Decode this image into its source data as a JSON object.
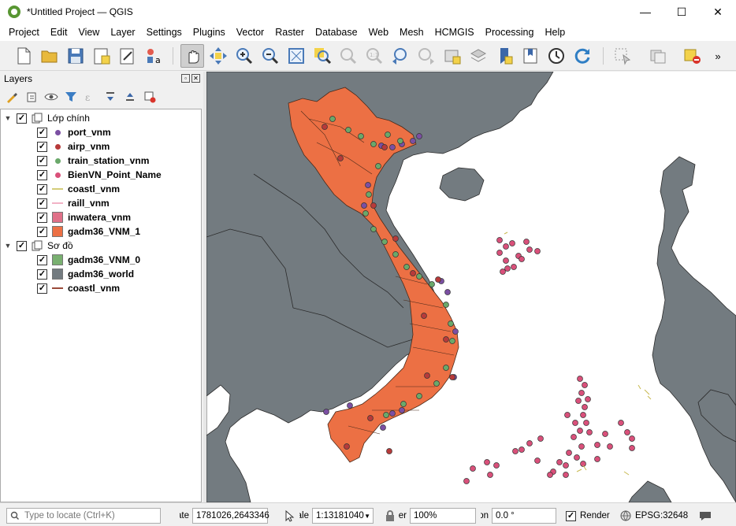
{
  "window": {
    "title": "*Untitled Project — QGIS",
    "minimize": "—",
    "maximize": "☐",
    "close": "✕"
  },
  "menu": [
    "Project",
    "Edit",
    "View",
    "Layer",
    "Settings",
    "Plugins",
    "Vector",
    "Raster",
    "Database",
    "Web",
    "Mesh",
    "HCMGIS",
    "Processing",
    "Help"
  ],
  "toolbar_icons": [
    "new-project-icon",
    "open-project-icon",
    "save-project-icon",
    "new-print-layout-icon",
    "style-manager-icon",
    "layer-styling-icon",
    "pan-map-icon",
    "pan-to-selection-icon",
    "zoom-in-icon",
    "zoom-out-icon",
    "zoom-full-icon",
    "zoom-to-selection-icon",
    "zoom-to-layer-icon",
    "zoom-native-icon",
    "zoom-last-icon",
    "zoom-next-icon",
    "new-bookmark-icon",
    "show-bookmarks-icon",
    "temporal-controller-icon",
    "refresh-icon",
    "select-features-icon",
    "deselect-icon",
    "more-tools-icon"
  ],
  "layers_panel": {
    "title": "Layers",
    "tools": [
      "open-styling-icon",
      "add-group-icon",
      "manage-visibility-icon",
      "filter-legend-icon",
      "filter-expression-icon",
      "expand-all-icon",
      "collapse-all-icon",
      "remove-layer-icon"
    ],
    "groups": [
      {
        "name": "Lớp chính",
        "checked": true,
        "expanded": true,
        "layers": [
          {
            "name": "port_vnm",
            "symbol": "point",
            "color": "#7b4fa3",
            "checked": true
          },
          {
            "name": "airp_vnm",
            "symbol": "point",
            "color": "#b73a3a",
            "checked": true
          },
          {
            "name": "train_station_vnm",
            "symbol": "point",
            "color": "#6aa86a",
            "checked": true
          },
          {
            "name": "BienVN_Point_Name",
            "symbol": "point",
            "color": "#d9507a",
            "checked": true
          },
          {
            "name": "coastl_vnm",
            "symbol": "line",
            "color": "#d4cc7a",
            "checked": true
          },
          {
            "name": "raill_vnm",
            "symbol": "line",
            "color": "#f2b2c6",
            "checked": true
          },
          {
            "name": "inwatera_vnm",
            "symbol": "fill",
            "color": "#e07088",
            "checked": true
          },
          {
            "name": "gadm36_VNM_1",
            "symbol": "fill",
            "color": "#ec7044",
            "checked": true
          }
        ]
      },
      {
        "name": "Sơ đồ",
        "checked": true,
        "expanded": true,
        "layers": [
          {
            "name": "gadm36_VNM_0",
            "symbol": "fill",
            "color": "#79b070",
            "checked": true
          },
          {
            "name": "gadm36_world",
            "symbol": "fill",
            "color": "#737b80",
            "checked": true
          },
          {
            "name": "coastl_vnm",
            "symbol": "line",
            "color": "#9a4a3a",
            "checked": true
          }
        ]
      }
    ]
  },
  "map": {
    "land_color": "#737b80",
    "sea_color": "#ffffff",
    "vietnam_color": "#ec7044",
    "border_color": "#2b2b2b"
  },
  "status": {
    "locate_placeholder": "Type to locate (Ctrl+K)",
    "coordinate_label": "Coordinate",
    "coordinate": "1781026,2643346",
    "scale_label": "Scale",
    "scale": "1:13181040",
    "magnifier_label": "Magnifier",
    "magnifier": "100%",
    "rotation_label": "Rotation",
    "rotation": "0.0 °",
    "render_label": "Render",
    "render_checked": true,
    "crs": "EPSG:32648"
  }
}
